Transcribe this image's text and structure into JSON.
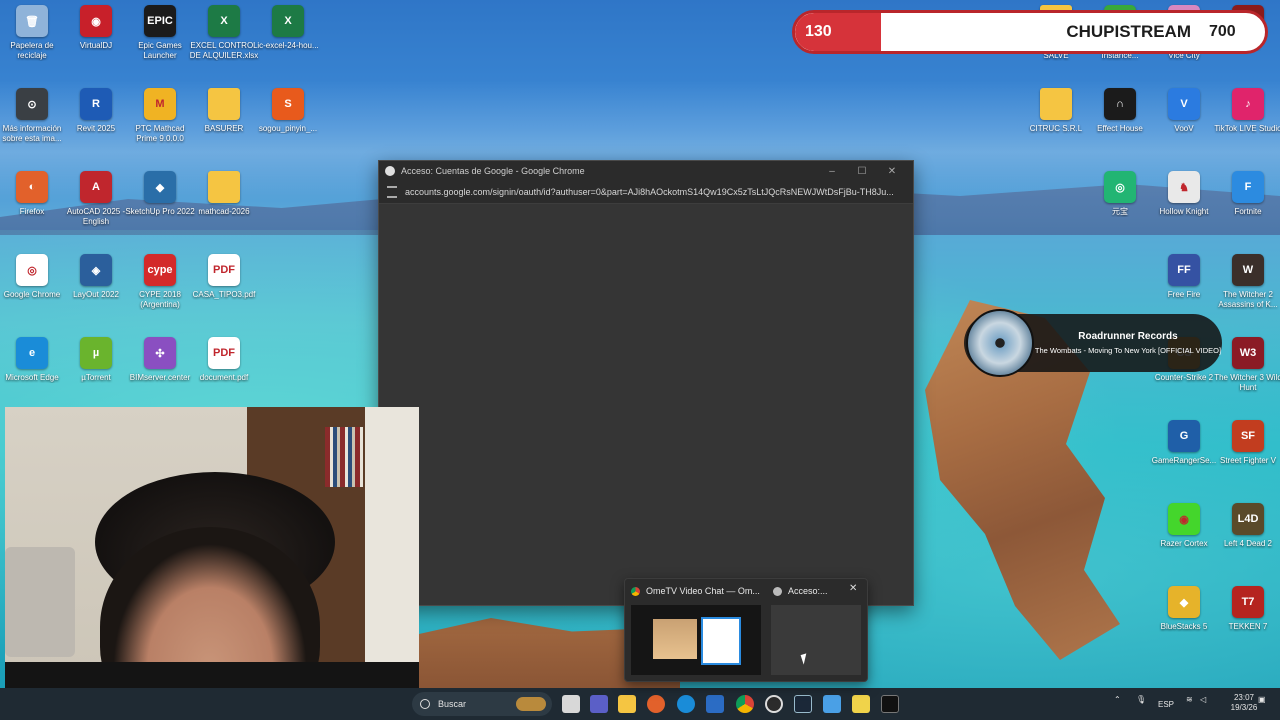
{
  "overlay": {
    "count": "130",
    "name": "CHUPISTREAM",
    "goal": "700"
  },
  "now_playing": {
    "title": "Roadrunner Records",
    "subtitle": "The Wombats - Moving To New York [OFFICIAL VIDEO]"
  },
  "chrome_window": {
    "title": "Acceso: Cuentas de Google - Google Chrome",
    "url": "accounts.google.com/signin/oauth/id?authuser=0&part=AJi8hAOckotmS14Qw19Cx5zTsLtJQcRsNEWJWtDsFjBu-TH8Ju..."
  },
  "desktop_icons": [
    {
      "label": "Papelera de reciclaje",
      "color": "#8fb3d9",
      "glyph": "🗑"
    },
    {
      "label": "VirtualDJ",
      "color": "#c8202a",
      "glyph": "◉"
    },
    {
      "label": "Epic Games Launcher",
      "color": "#1b1b1b",
      "glyph": "EPIC"
    },
    {
      "label": "EXCEL CONTROL DE ALQUILER.xlsx",
      "color": "#1d7a45",
      "glyph": "X"
    },
    {
      "label": "ic-excel-24-hou...",
      "color": "#1d7a45",
      "glyph": "X"
    },
    {
      "label": "Más información sobre esta ima...",
      "color": "#3a3f44",
      "glyph": "⊙"
    },
    {
      "label": "Revit 2025",
      "color": "#1e5bb5",
      "glyph": "R"
    },
    {
      "label": "PTC Mathcad Prime 9.0.0.0",
      "color": "#f0b323",
      "glyph": "M"
    },
    {
      "label": "BASURER",
      "color": "#f5c542",
      "glyph": ""
    },
    {
      "label": "sogou_pinyin_...",
      "color": "#e85a1c",
      "glyph": "S"
    },
    {
      "label": "Firefox",
      "color": "#e2612b",
      "glyph": "◐"
    },
    {
      "label": "AutoCAD 2025 - English",
      "color": "#c0262d",
      "glyph": "A"
    },
    {
      "label": "SketchUp Pro 2022",
      "color": "#2a6ea8",
      "glyph": "◆"
    },
    {
      "label": "mathcad-2026",
      "color": "#f5c542",
      "glyph": ""
    },
    {
      "label": "Google Chrome",
      "color": "#ffffff",
      "glyph": "◎"
    },
    {
      "label": "LayOut 2022",
      "color": "#2b5f9c",
      "glyph": "◈"
    },
    {
      "label": "CYPE 2018 (Argentina)",
      "color": "#d32a2a",
      "glyph": "cype"
    },
    {
      "label": "CASA_TIPO3.pdf",
      "color": "#ffffff",
      "glyph": "PDF"
    },
    {
      "label": "Microsoft Edge",
      "color": "#1a8cd8",
      "glyph": "e"
    },
    {
      "label": "µTorrent",
      "color": "#6ab42d",
      "glyph": "µ"
    },
    {
      "label": "BIMserver.center",
      "color": "#8a4fc1",
      "glyph": "✣"
    },
    {
      "label": "document.pdf",
      "color": "#ffffff",
      "glyph": "PDF"
    },
    {
      "label": "FOTOS YA ME SALVE",
      "color": "#f5c542",
      "glyph": ""
    },
    {
      "label": "BlueStacks Multi-Instance...",
      "color": "#39a83a",
      "glyph": "▲"
    },
    {
      "label": "Grand Theft Auto Vice City",
      "color": "#d888c0",
      "glyph": "GTA"
    },
    {
      "label": "Dota 2",
      "color": "#8b1b1b",
      "glyph": "D"
    },
    {
      "label": "CITRUC S.R.L",
      "color": "#f5c542",
      "glyph": ""
    },
    {
      "label": "Effect House",
      "color": "#1b1b1b",
      "glyph": "∩"
    },
    {
      "label": "VooV",
      "color": "#2b7be0",
      "glyph": "V"
    },
    {
      "label": "TikTok LIVE Studio",
      "color": "#e0246b",
      "glyph": "♪"
    },
    {
      "label": "元宝",
      "color": "#22b573",
      "glyph": "◎"
    },
    {
      "label": "Hollow Knight",
      "color": "#e9e9e9",
      "glyph": "♞"
    },
    {
      "label": "Fortnite",
      "color": "#2c8be0",
      "glyph": "F"
    },
    {
      "label": "Free Fire",
      "color": "#3552a3",
      "glyph": "FF"
    },
    {
      "label": "The Witcher 2 Assassins of K...",
      "color": "#3b2f2a",
      "glyph": "W"
    },
    {
      "label": "Counter-Strike 2",
      "color": "#c9902a",
      "glyph": "CS"
    },
    {
      "label": "The Witcher 3 Wild Hunt",
      "color": "#8b1b25",
      "glyph": "W3"
    },
    {
      "label": "GameRangerSe...",
      "color": "#1f5fa8",
      "glyph": "G"
    },
    {
      "label": "Street Fighter V",
      "color": "#c23d1f",
      "glyph": "SF"
    },
    {
      "label": "Razer Cortex",
      "color": "#44d62c",
      "glyph": "◉"
    },
    {
      "label": "Left 4 Dead 2",
      "color": "#5a4a2a",
      "glyph": "L4D"
    },
    {
      "label": "BlueStacks 5",
      "color": "#e6b32a",
      "glyph": "◆"
    },
    {
      "label": "TEKKEN 7",
      "color": "#b5241f",
      "glyph": "T7"
    }
  ],
  "preview": {
    "tab1": "OmeTV Video Chat — Om...",
    "tab2": "Acceso:...",
    "close": "✕"
  },
  "taskbar": {
    "search_placeholder": "Buscar",
    "language": "ESP",
    "time": "23:07",
    "date": "19/3/26"
  }
}
